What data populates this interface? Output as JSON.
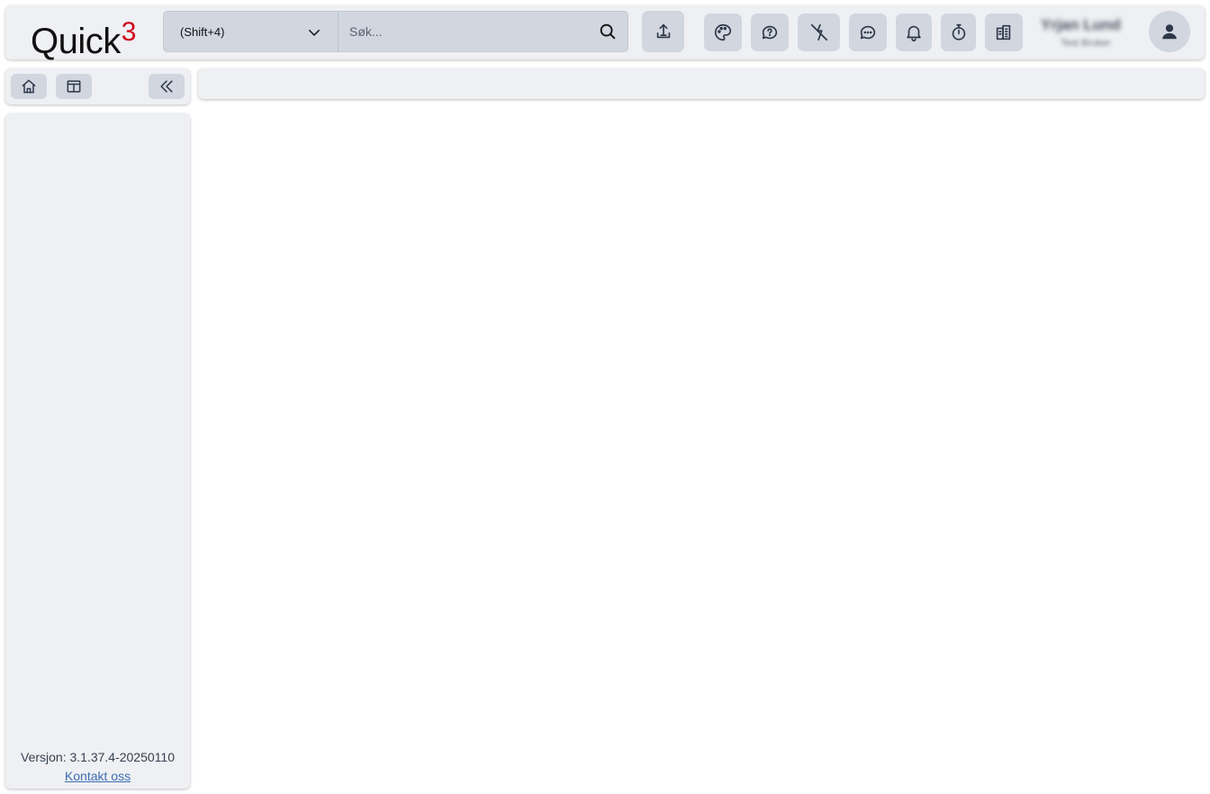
{
  "brand": {
    "name": "Quick",
    "suffix": "3",
    "suffix_color": "#d0021b"
  },
  "search": {
    "scope_label": "(Shift+4)",
    "placeholder": "Søk...",
    "value": ""
  },
  "toolbar_icons": [
    "upload-icon",
    "palette-icon",
    "help-icon",
    "flash-off-icon",
    "chat-icon",
    "bell-icon",
    "stopwatch-icon",
    "building-icon"
  ],
  "user": {
    "name": "Yrjan Lund",
    "role": "Test Bruker"
  },
  "sidebar": {
    "version": "Versjon: 3.1.37.4-20250110",
    "contact_link": "Kontakt oss"
  },
  "colors": {
    "panel_bg": "#eff0f3",
    "button_bg": "#d1d6df",
    "icon_color": "#2d3748",
    "link": "#3b6db3"
  }
}
